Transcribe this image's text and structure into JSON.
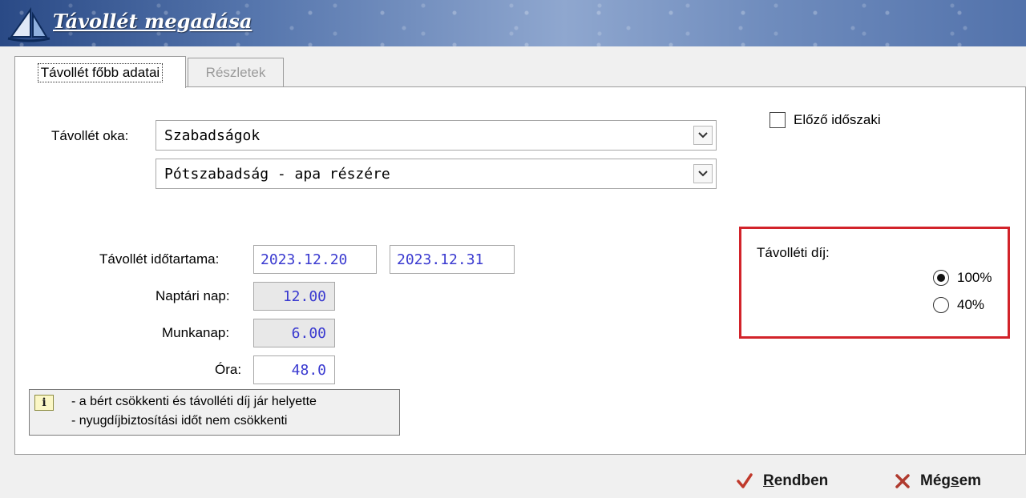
{
  "window": {
    "title": "Távollét megadása"
  },
  "tabs": [
    {
      "label": "Távollét főbb adatai",
      "active": true
    },
    {
      "label": "Részletek",
      "active": false
    }
  ],
  "form": {
    "reason_label": "Távollét oka:",
    "reason_value": "Szabadságok",
    "subreason_value": "Pótszabadság - apa részére",
    "previous_period_label": "Előző időszaki",
    "previous_period_checked": false,
    "duration_label": "Távollét időtartama:",
    "date_from": "2023.12.20",
    "date_to": "2023.12.31",
    "calendar_days_label": "Naptári nap:",
    "calendar_days_value": "12.00",
    "workdays_label": "Munkanap:",
    "workdays_value": "6.00",
    "hours_label": "Óra:",
    "hours_value": "48.0"
  },
  "absence_fee": {
    "label": "Távolléti díj:",
    "options": [
      {
        "label": "100%",
        "selected": true
      },
      {
        "label": "40%",
        "selected": false
      }
    ],
    "highlight_color": "#d2232a"
  },
  "info": {
    "icon_text": "i",
    "line1": "- a bért csökkenti és távolléti díj jár helyette",
    "line2": "- nyugdíjbiztosítási időt nem csökkenti"
  },
  "buttons": {
    "ok_underlined": "R",
    "ok_rest": "endben",
    "cancel_before": "Még",
    "cancel_underlined": "s",
    "cancel_after": "em"
  },
  "colors": {
    "value_text": "#3a3ad0",
    "ok_check": "#c0392b",
    "cancel_x": "#b03a2e"
  }
}
